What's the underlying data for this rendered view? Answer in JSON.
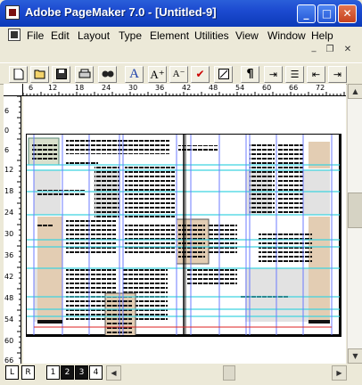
{
  "window": {
    "title": "Adobe PageMaker 7.0 - [Untitled-9]",
    "minimize_symbol": "_",
    "maximize_symbol": "□",
    "close_symbol": "✕"
  },
  "menu": {
    "items": [
      {
        "label": "File",
        "key": "F"
      },
      {
        "label": "Edit",
        "key": "E"
      },
      {
        "label": "Layout",
        "key": "L"
      },
      {
        "label": "Type",
        "key": "T"
      },
      {
        "label": "Element",
        "key": "m"
      },
      {
        "label": "Utilities",
        "key": "U"
      },
      {
        "label": "View",
        "key": "V"
      },
      {
        "label": "Window",
        "key": "W"
      },
      {
        "label": "Help",
        "key": "H"
      }
    ],
    "doc_minimize": "_",
    "doc_restore": "❐",
    "doc_close": "✕"
  },
  "toolbar": {
    "tools": [
      {
        "name": "new-icon",
        "glyph": "🗋"
      },
      {
        "name": "open-icon",
        "glyph": "📂"
      },
      {
        "name": "save-icon",
        "glyph": "💾"
      },
      {
        "name": "print-icon",
        "glyph": "🖶"
      },
      {
        "name": "find-icon",
        "glyph": "🔍"
      },
      {
        "name": "font-icon",
        "glyph": "A"
      },
      {
        "name": "font-size-up-icon",
        "glyph": "A⁺"
      },
      {
        "name": "font-size-down-icon",
        "glyph": "A⁻"
      },
      {
        "name": "spelling-icon",
        "glyph": "✔"
      },
      {
        "name": "fill-icon",
        "glyph": "▨"
      },
      {
        "name": "paragraph-icon",
        "glyph": "¶"
      },
      {
        "name": "tab-icon",
        "glyph": "⇥"
      },
      {
        "name": "bullets-icon",
        "glyph": "☰"
      },
      {
        "name": "indent-icon",
        "glyph": "⇤"
      },
      {
        "name": "outdent-icon",
        "glyph": "⇥"
      }
    ]
  },
  "rulers": {
    "horizontal": [
      "6",
      "12",
      "18",
      "24",
      "30",
      "36",
      "42",
      "48",
      "54",
      "60",
      "66",
      "72"
    ],
    "vertical": [
      "6",
      "0",
      "6",
      "12",
      "18",
      "24",
      "30",
      "36",
      "42",
      "48",
      "54",
      "60",
      "66"
    ]
  },
  "pages": {
    "master_left": "L",
    "master_right": "R",
    "page_tabs": [
      "1",
      "2",
      "3",
      "4"
    ],
    "active_pages": [
      "2",
      "3"
    ]
  },
  "colors": {
    "titlebar": "#0b3ab8",
    "guide_blue": "#6c7bff",
    "guide_cyan": "#3fd4e0",
    "frame_tan": "#e3cdb3",
    "frame_grey": "#e2e2e2"
  }
}
